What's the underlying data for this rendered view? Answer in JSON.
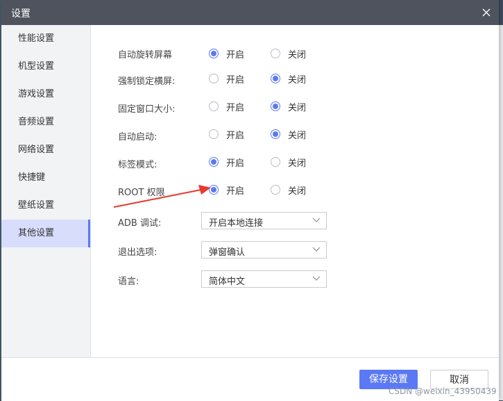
{
  "window": {
    "title": "设置"
  },
  "sidebar": {
    "items": [
      {
        "label": "性能设置"
      },
      {
        "label": "机型设置"
      },
      {
        "label": "游戏设置"
      },
      {
        "label": "音频设置"
      },
      {
        "label": "网络设置"
      },
      {
        "label": "快捷键"
      },
      {
        "label": "壁纸设置"
      },
      {
        "label": "其他设置",
        "selected": true
      }
    ]
  },
  "settings": {
    "on_label": "开启",
    "off_label": "关闭",
    "rows": [
      {
        "label": "自动旋转屏幕",
        "value": "开启"
      },
      {
        "label": "强制锁定横屏:",
        "value": "关闭"
      },
      {
        "label": "固定窗口大小:",
        "value": "关闭"
      },
      {
        "label": "自动启动:",
        "value": "关闭"
      },
      {
        "label": "标签模式:",
        "value": "开启"
      },
      {
        "label": "ROOT 权限",
        "value": "开启"
      }
    ],
    "selects": [
      {
        "label": "ADB 调试:",
        "value": "开启本地连接"
      },
      {
        "label": "退出选项:",
        "value": "弹窗确认"
      },
      {
        "label": "语言:",
        "value": "简体中文"
      }
    ]
  },
  "footer": {
    "save_label": "保存设置",
    "cancel_label": "取消"
  },
  "watermark": "CSDN @weixin_43950439",
  "colors": {
    "accent": "#5b79f4",
    "titlebar": "#4e535d",
    "sidebar_active": "#d7ddfb",
    "arrow": "#e8392e"
  },
  "icons": [
    "close-icon",
    "chevron-down-icon",
    "red-arrow-annotation"
  ]
}
